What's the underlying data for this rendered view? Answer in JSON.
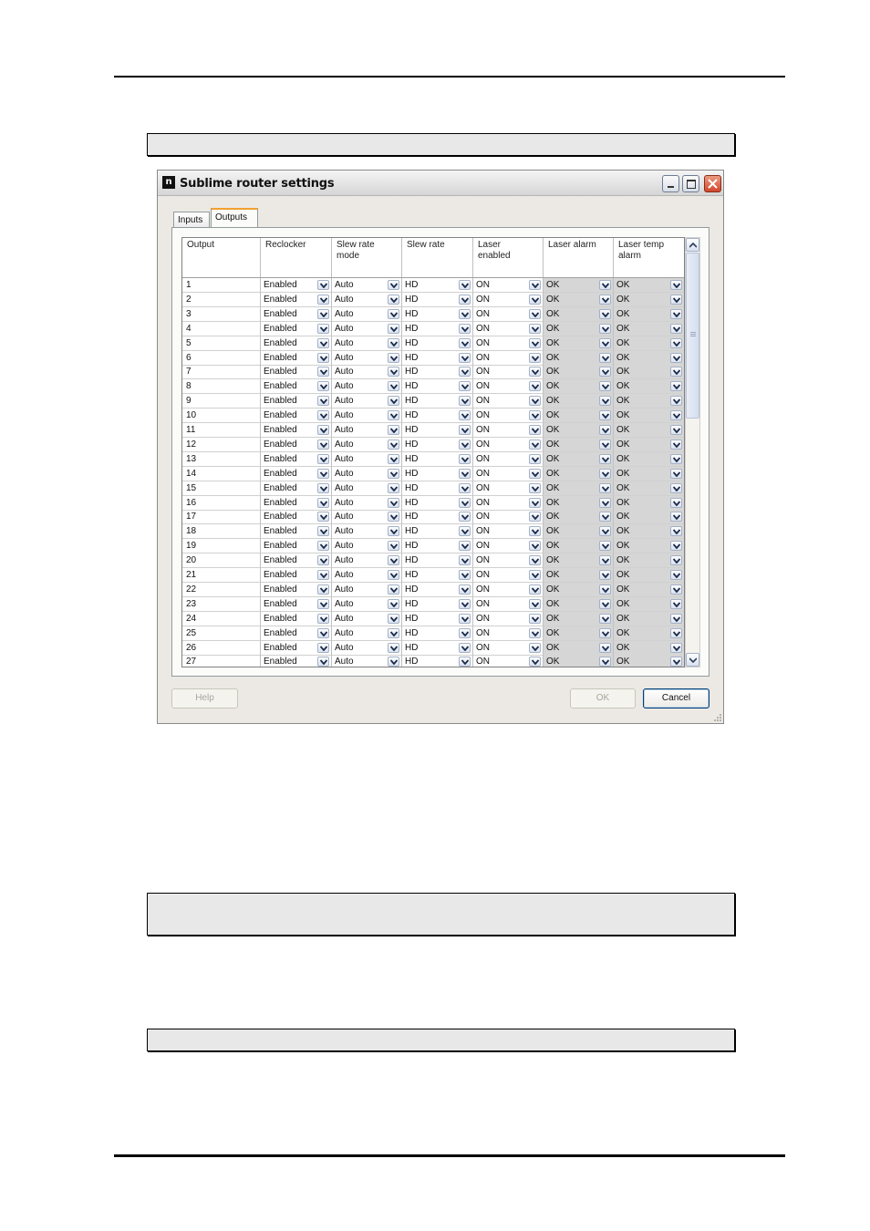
{
  "window": {
    "title": "Sublime router settings",
    "app_icon": "n"
  },
  "tabs": [
    {
      "label": "Inputs"
    },
    {
      "label": "Outputs"
    }
  ],
  "columns": [
    {
      "line1": "Output",
      "line2": ""
    },
    {
      "line1": "Reclocker",
      "line2": ""
    },
    {
      "line1": "Slew rate",
      "line2": "mode"
    },
    {
      "line1": "Slew rate",
      "line2": ""
    },
    {
      "line1": "Laser",
      "line2": "enabled"
    },
    {
      "line1": "Laser alarm",
      "line2": ""
    },
    {
      "line1": "Laser temp",
      "line2": "alarm"
    }
  ],
  "row_defaults": {
    "reclocker": "Enabled",
    "slew_mode": "Auto",
    "slew_rate": "HD",
    "laser_enabled": "ON",
    "laser_alarm": "OK",
    "laser_temp_alarm": "OK"
  },
  "rows": [
    "1",
    "2",
    "3",
    "4",
    "5",
    "6",
    "7",
    "8",
    "9",
    "10",
    "11",
    "12",
    "13",
    "14",
    "15",
    "16",
    "17",
    "18",
    "19",
    "20",
    "21",
    "22",
    "23",
    "24",
    "25",
    "26",
    "27"
  ],
  "buttons": {
    "help": "Help",
    "ok": "OK",
    "cancel": "Cancel"
  },
  "colors": {
    "alarm_cell_bg": "#d6d6d6",
    "active_tab_accent": "#f0a030"
  }
}
